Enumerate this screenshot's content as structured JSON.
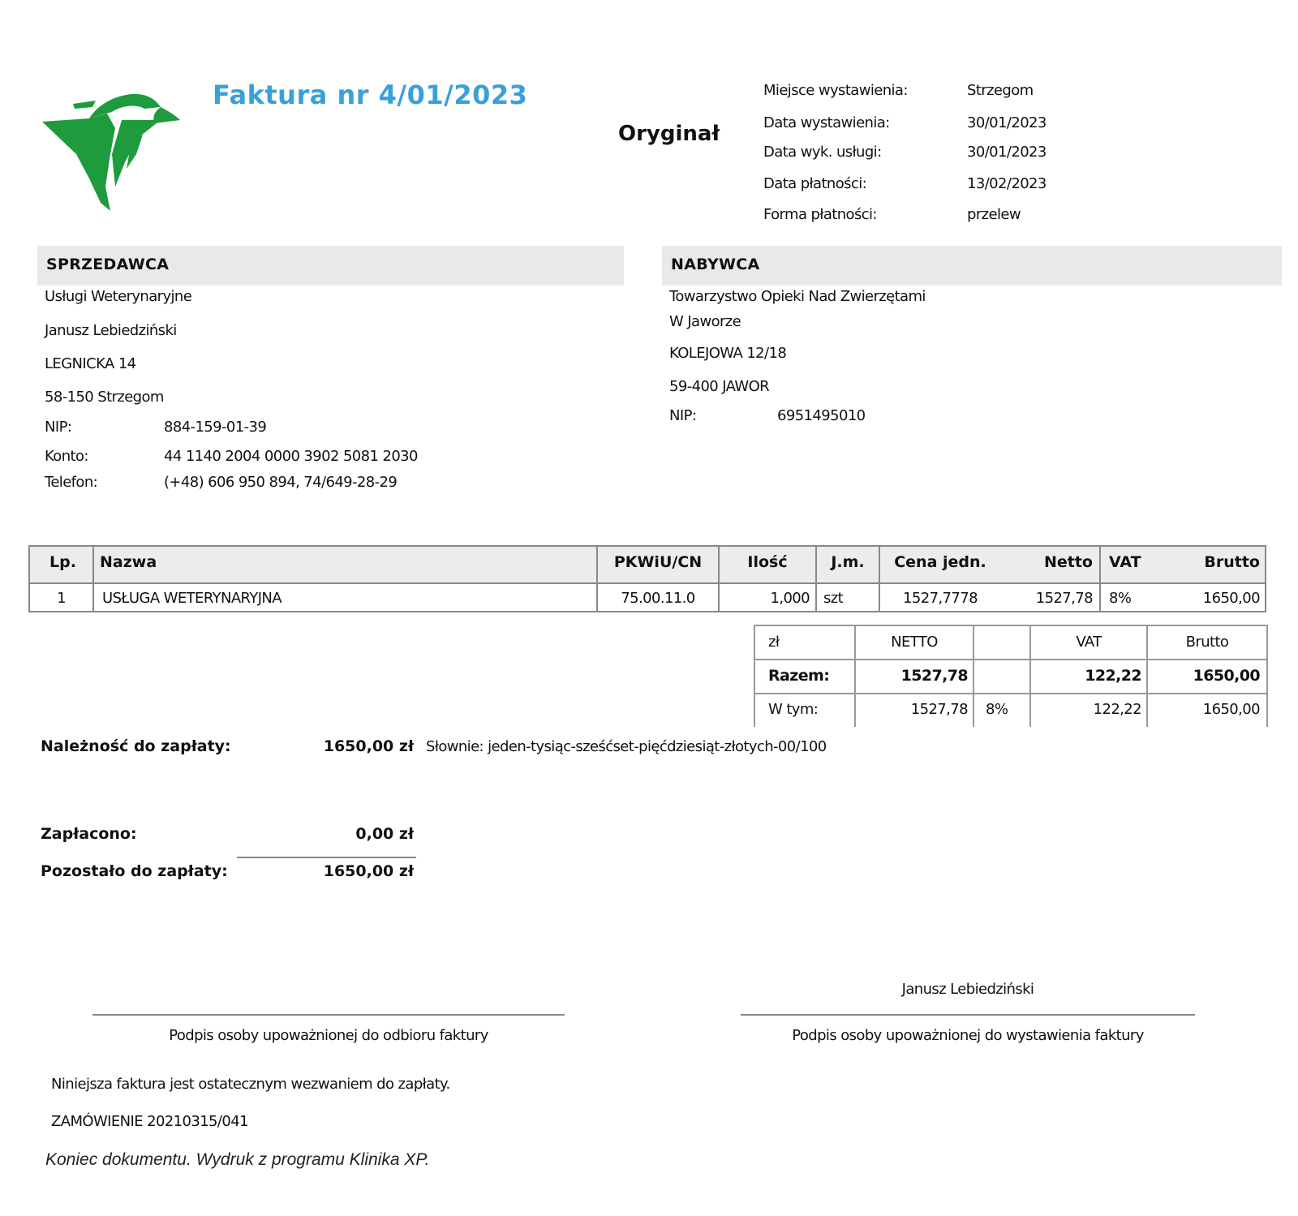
{
  "title": "Faktura nr 4/01/2023",
  "copy_label": "Oryginał",
  "logo": {
    "color": "#1e9b3c",
    "description_icon": "veterinary-logo"
  },
  "meta": [
    {
      "label": "Miejsce wystawienia:",
      "value": "Strzegom"
    },
    {
      "label": "Data wystawienia:",
      "value": "30/01/2023"
    },
    {
      "label": "Data wyk. usługi:",
      "value": "30/01/2023"
    },
    {
      "label": "Data płatności:",
      "value": "13/02/2023"
    },
    {
      "label": "Forma płatności:",
      "value": "przelew"
    }
  ],
  "seller": {
    "heading": "SPRZEDAWCA",
    "lines": [
      "Usługi Weterynaryjne",
      "Janusz Lebiedziński",
      "LEGNICKA 14",
      "58-150 Strzegom"
    ],
    "nip_label": "NIP:",
    "nip": "884-159-01-39",
    "account_label": "Konto:",
    "account": "44 1140 2004 0000 3902 5081 2030",
    "phone_label": "Telefon:",
    "phone": "(+48) 606 950 894, 74/649-28-29"
  },
  "buyer": {
    "heading": "NABYWCA",
    "lines": [
      "Towarzystwo Opieki Nad Zwierzętami",
      "W Jaworze",
      "KOLEJOWA 12/18",
      "59-400 JAWOR"
    ],
    "nip_label": "NIP:",
    "nip": "6951495010"
  },
  "items": {
    "headers": {
      "lp": "Lp.",
      "name": "Nazwa",
      "pkwiu": "PKWiU/CN",
      "qty": "Ilość",
      "unit": "J.m.",
      "price": "Cena jedn.",
      "net": "Netto",
      "vat": "VAT",
      "gross": "Brutto"
    },
    "rows": [
      {
        "lp": "1",
        "name": "USŁUGA WETERYNARYJNA",
        "pkwiu": "75.00.11.0",
        "qty": "1,000",
        "unit": "szt",
        "price": "1527,7778",
        "net": "1527,78",
        "vat": "8%",
        "gross": "1650,00"
      }
    ]
  },
  "totals": {
    "currency": "zł",
    "net_label": "NETTO",
    "vat_label": "VAT",
    "gross_label": "Brutto",
    "sum_label": "Razem:",
    "sum_net": "1527,78",
    "sum_vat": "122,22",
    "sum_gross": "1650,00",
    "incl_label": "W tym:",
    "incl_net": "1527,78",
    "incl_rate": "8%",
    "incl_vat": "122,22",
    "incl_gross": "1650,00"
  },
  "due": {
    "label": "Należność do zapłaty:",
    "amount": "1650,00 zł",
    "words": "Słownie: jeden-tysiąc-sześćset-pięćdziesiąt-złotych-00/100"
  },
  "paid": {
    "label": "Zapłacono:",
    "amount": "0,00 zł"
  },
  "remaining": {
    "label": "Pozostało do zapłaty:",
    "amount": "1650,00 zł"
  },
  "signatures": {
    "receiver_caption": "Podpis osoby upoważnionej do odbioru faktury",
    "issuer_name": "Janusz Lebiedziński",
    "issuer_caption": "Podpis osoby upoważnionej do wystawienia faktury"
  },
  "notes": [
    "Niniejsza faktura jest ostatecznym wezwaniem do zapłaty.",
    "ZAMÓWIENIE 20210315/041"
  ],
  "footer": "Koniec dokumentu. Wydruk z programu Klinika XP."
}
